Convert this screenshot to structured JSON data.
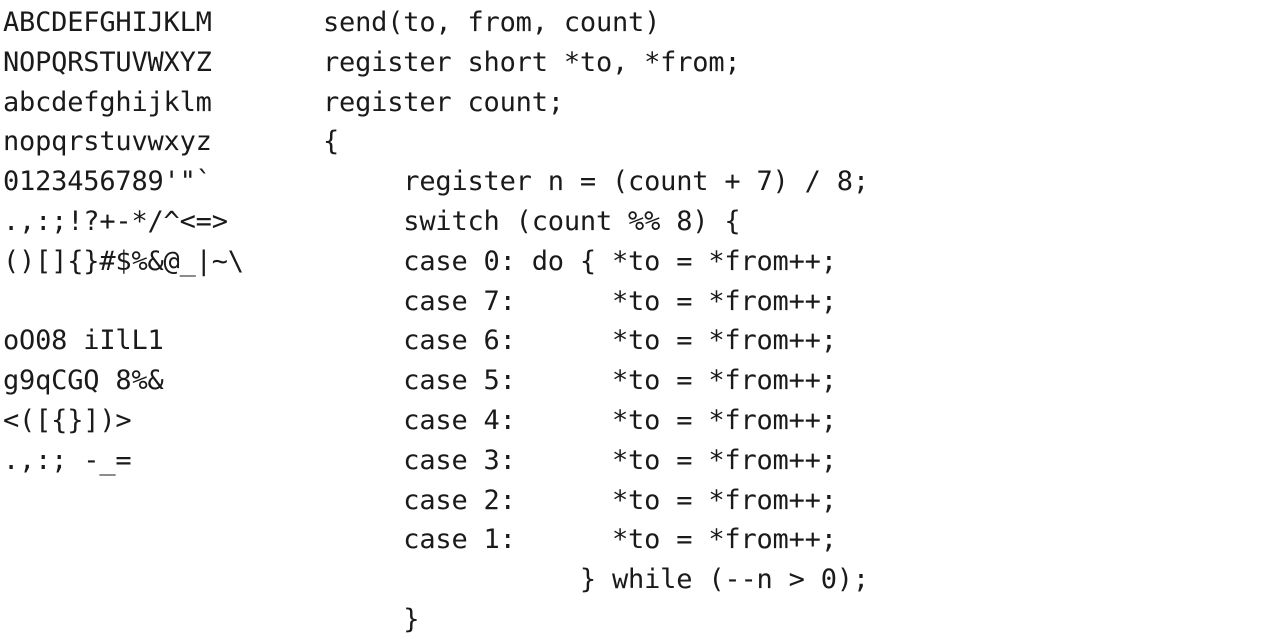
{
  "glyphs": [
    "ABCDEFGHIJKLM",
    "NOPQRSTUVWXYZ",
    "abcdefghijklm",
    "nopqrstuvwxyz",
    "0123456789'\"`",
    ".,:;!?+-*/^<=>",
    "()[]{}#$%&@_|~\\",
    "",
    "oO08 iIlL1",
    "g9qCGQ 8%&",
    "<([{}])>",
    ".,:; -_="
  ],
  "code": [
    "send(to, from, count)",
    "register short *to, *from;",
    "register count;",
    "{",
    "     register n = (count + 7) / 8;",
    "     switch (count %% 8) {",
    "     case 0: do { *to = *from++;",
    "     case 7:      *to = *from++;",
    "     case 6:      *to = *from++;",
    "     case 5:      *to = *from++;",
    "     case 4:      *to = *from++;",
    "     case 3:      *to = *from++;",
    "     case 2:      *to = *from++;",
    "     case 1:      *to = *from++;",
    "                } while (--n > 0);",
    "     }"
  ]
}
